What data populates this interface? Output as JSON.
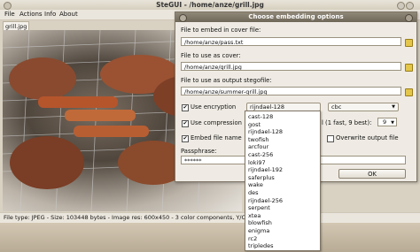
{
  "window": {
    "title": "SteGUI - /home/anze/grill.jpg"
  },
  "menu": {
    "file": "File",
    "actions": "Actions",
    "info": "Info",
    "about": "About"
  },
  "tab": {
    "label": "grill.jpg"
  },
  "status": {
    "text": "File type: JPEG - Size: 103448 bytes - Image res: 600x450 - 3 color components, Y/Cb/Cr (YUV) color space"
  },
  "dialog": {
    "title": "Choose embedding options",
    "cover_file_label": "File to embed in cover file:",
    "cover_file_value": "/home/anze/pass.txt",
    "cover_label": "File to use as cover:",
    "cover_value": "/home/anze/grill.jpg",
    "output_label": "File to use as output stegofile:",
    "output_value": "/home/anze/summer-grill.jpg",
    "use_encryption": "Use encryption",
    "encryption_algo": "rijndael-128",
    "encryption_mode": "cbc",
    "use_compression": "Use compression",
    "compression_hint": "l (1 fast, 9 best):",
    "compression_level": "9",
    "embed_name": "Embed file name",
    "overwrite": "Overwrite output file",
    "passphrase_label": "Passphrase:",
    "passphrase_value": "******",
    "ok": "OK"
  },
  "dropdown": {
    "options": [
      "cast-128",
      "gost",
      "rijndael-128",
      "twofish",
      "arcfour",
      "cast-256",
      "loki97",
      "rijndael-192",
      "saferplus",
      "wake",
      "des",
      "rijndael-256",
      "serpent",
      "xtea",
      "blowfish",
      "enigma",
      "rc2",
      "tripledes"
    ]
  }
}
